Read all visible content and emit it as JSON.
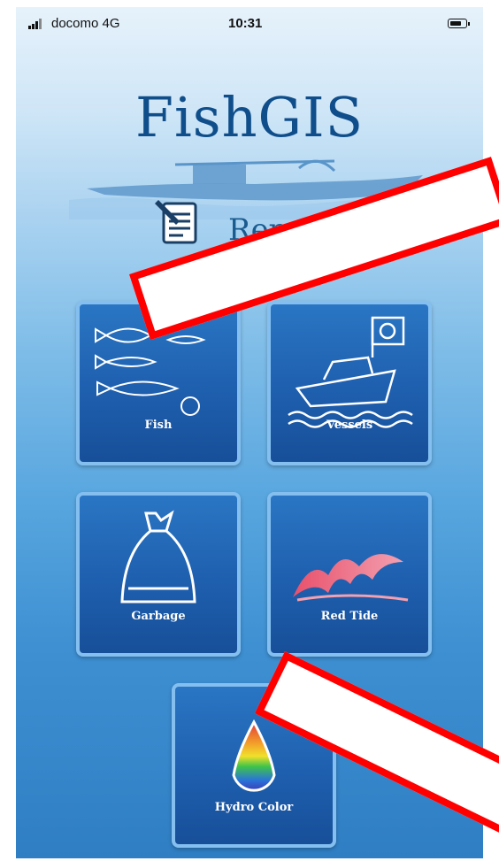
{
  "status_bar": {
    "carrier": "docomo  4G",
    "time": "10:31"
  },
  "app": {
    "title": "FishGIS",
    "subtitle": "Report"
  },
  "tiles": {
    "fish": {
      "label": "Fish",
      "icon": "fish-icon"
    },
    "vessels": {
      "label": "Vessels",
      "icon": "boat-icon"
    },
    "garbage": {
      "label": "Garbage",
      "icon": "garbage-bag-icon"
    },
    "red_tide": {
      "label": "Red Tide",
      "icon": "wave-icon"
    },
    "hydro_color": {
      "label": "Hydro Color",
      "icon": "water-drop-icon"
    }
  },
  "colors": {
    "title_blue": "#0f4e8a",
    "tile_blue": "#1e5fae",
    "tile_border": "#84bff0",
    "callout_red": "#ff0000"
  }
}
